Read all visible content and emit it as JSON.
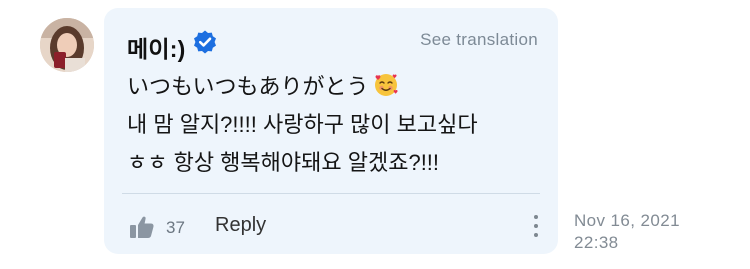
{
  "comment": {
    "author": "메이:)",
    "verified_icon": "verified-check-icon",
    "see_translation": "See translation",
    "lines": [
      "いつもいつもありがとう",
      "내 맘 알지?!!!! 사랑하구 많이 보고싶다",
      "ㅎㅎ 항상 행복해야돼요 알겠죠?!!!"
    ],
    "emoji": "smiling-face-with-hearts",
    "like_count": "37",
    "reply_label": "Reply",
    "timestamp_date": "Nov 16, 2021",
    "timestamp_time": "22:38"
  },
  "colors": {
    "bubble": "#eef5fc",
    "verified": "#1d6fe0",
    "muted_text": "#7d8a96"
  }
}
